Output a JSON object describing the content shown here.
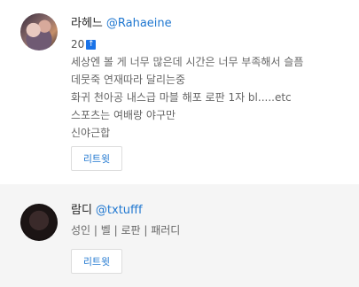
{
  "users": [
    {
      "display_name": "라헤느",
      "handle": "@Rahaeine",
      "badge_count": "20",
      "badge_icon": "up-arrow-badge-icon",
      "bio_lines": [
        "세상엔 볼 게 너무 많은데 시간은 너무 부족해서 슬픔",
        "데뭇죽 연재따라 달리는중",
        "화귀 천아공 내스급 마블 해포 로판 1자 bl.....etc",
        "스포츠는 여배랑 야구만",
        "신야근합"
      ],
      "retweet_label": "리트윗"
    },
    {
      "display_name": "람디",
      "handle": "@txtufff",
      "bio_lines": [
        "성인 | 벨 | 로판 | 패러디"
      ],
      "retweet_label": "리트윗"
    }
  ],
  "colors": {
    "handle": "#1f77d0",
    "card_alt_background": "#f5f5f5",
    "badge": "#1a73e8"
  }
}
